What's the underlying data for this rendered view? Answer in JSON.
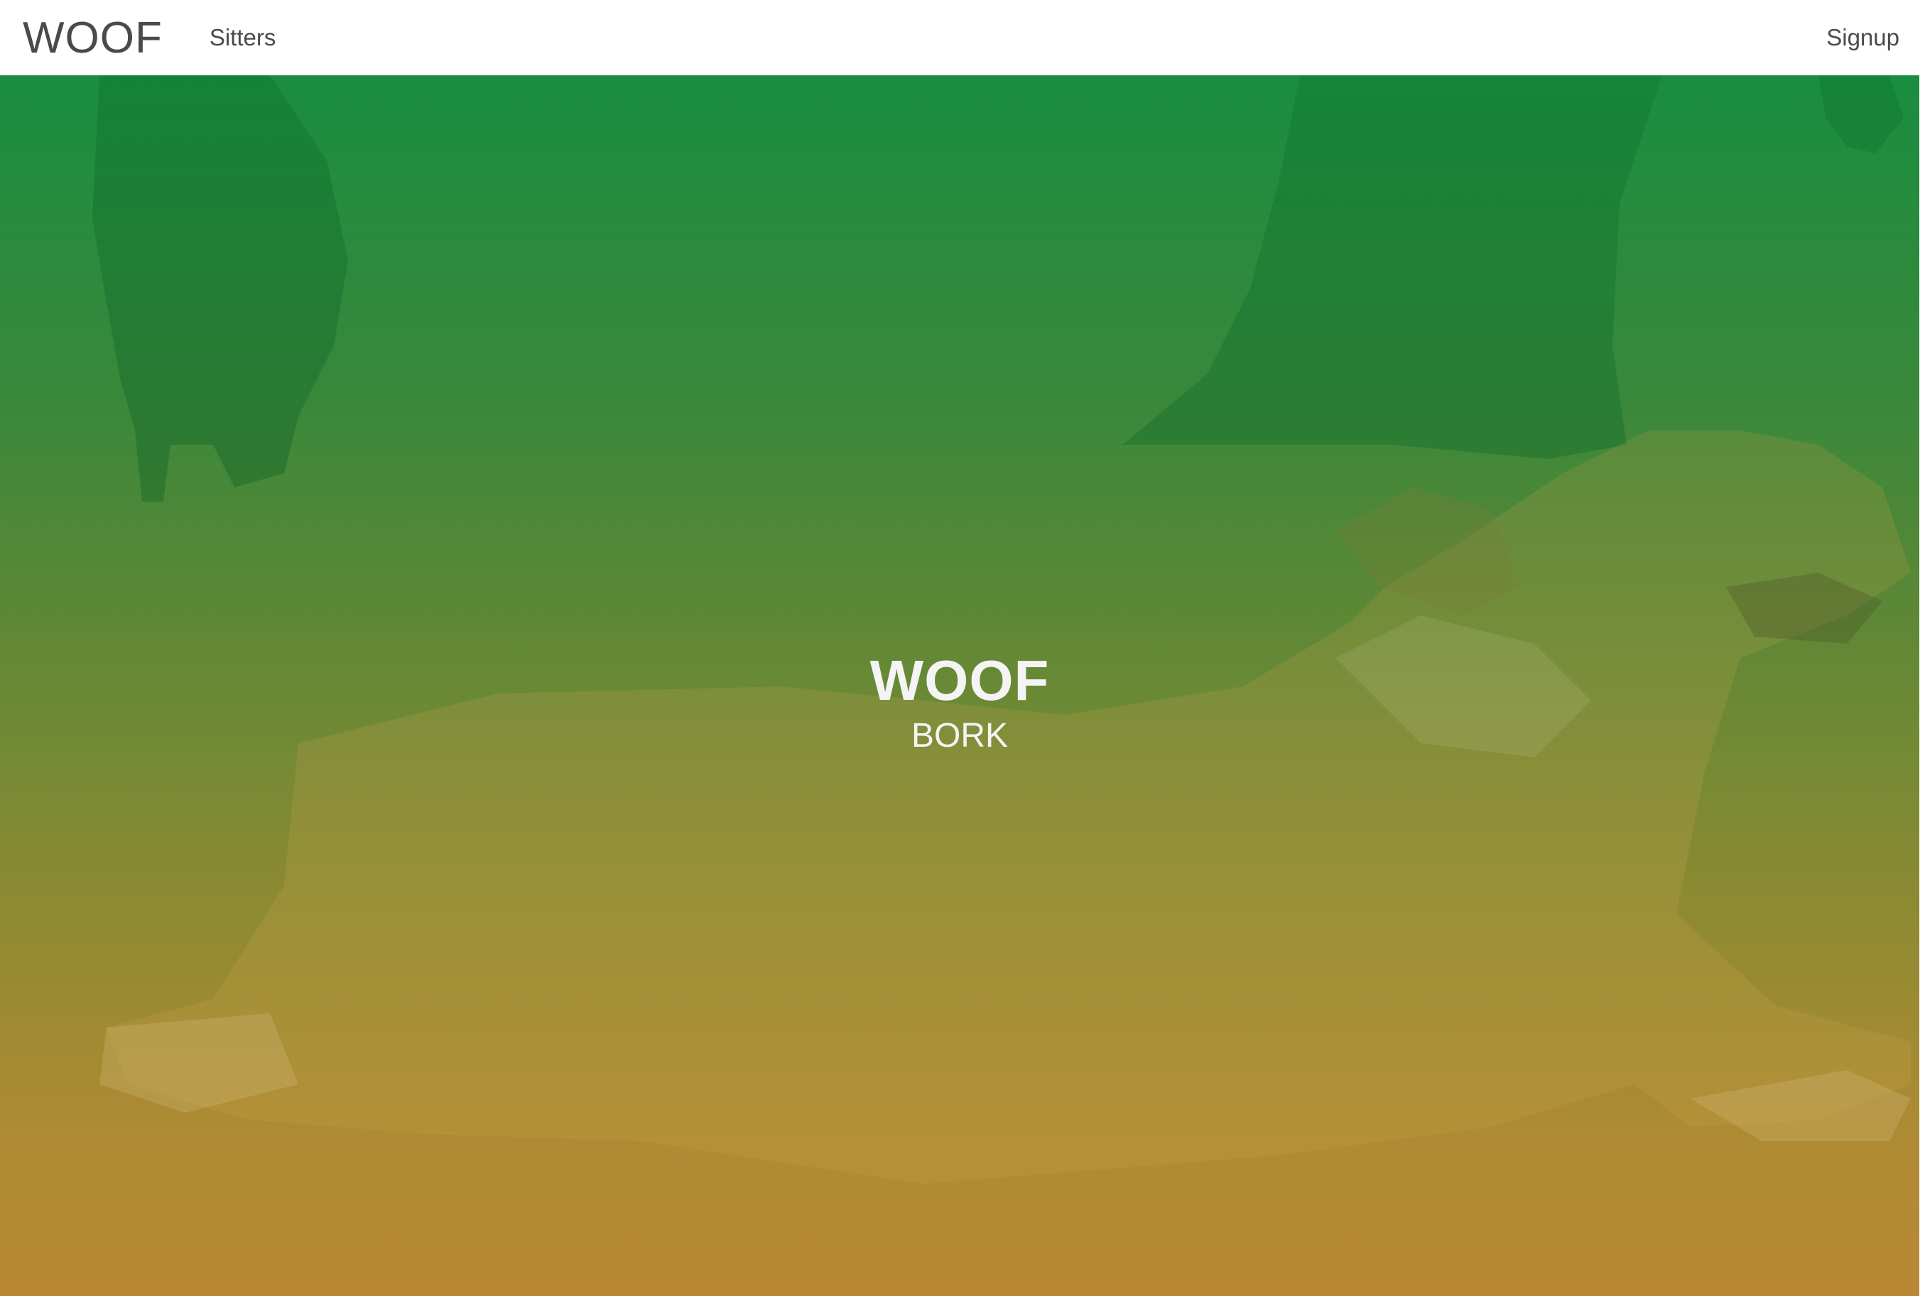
{
  "navbar": {
    "brand": "WOOF",
    "links": [
      {
        "label": "Sitters"
      }
    ],
    "signup_label": "Signup"
  },
  "hero": {
    "title": "WOOF",
    "subtitle": "BORK",
    "image_subject": "dog-lying-on-sand-photo",
    "gradient_colors": [
      "#1f8e45",
      "#6b8a38",
      "#b7863a"
    ]
  }
}
